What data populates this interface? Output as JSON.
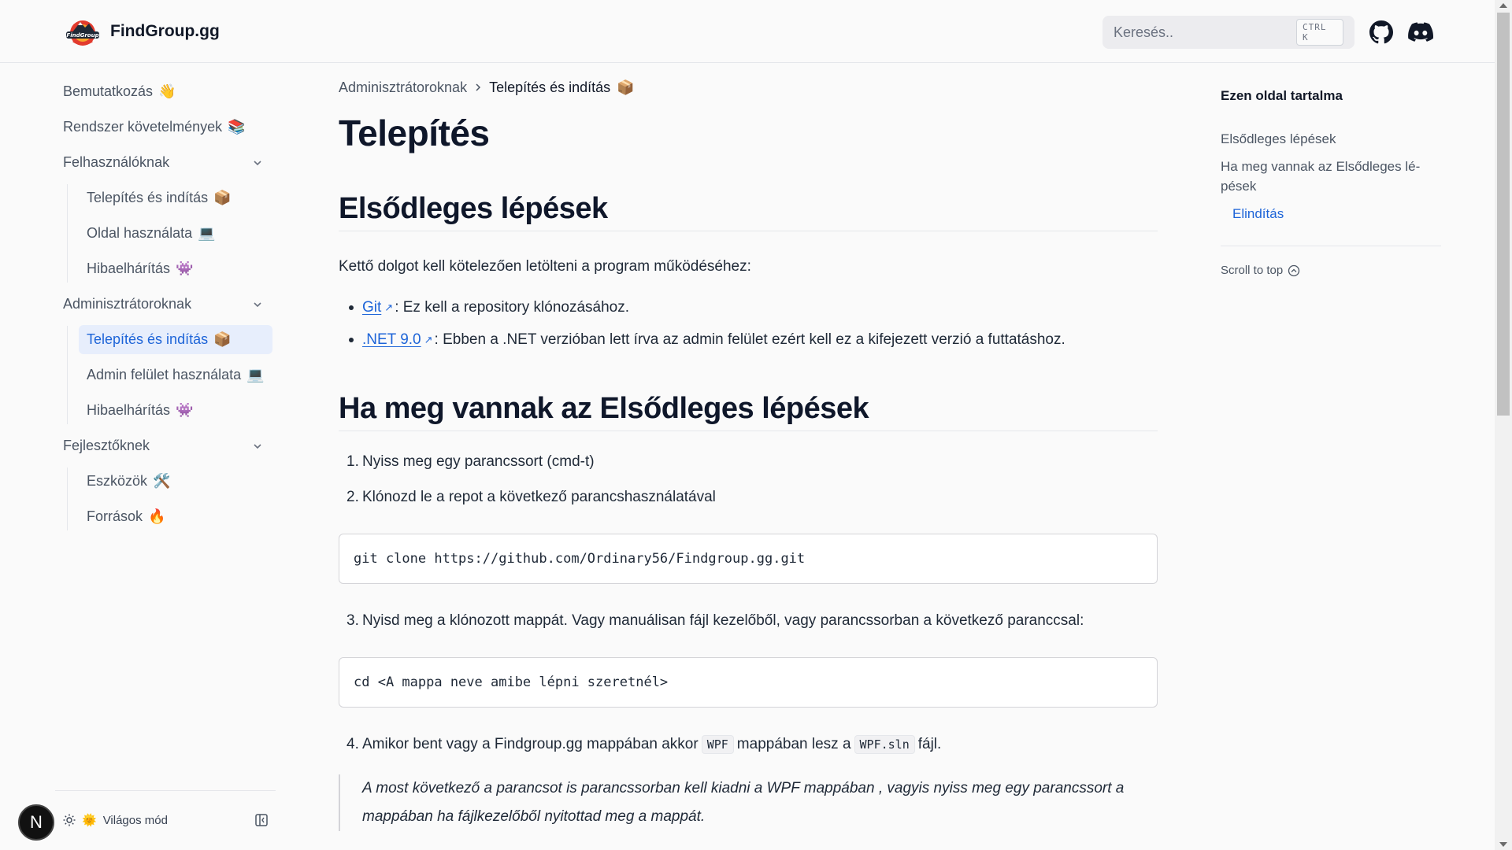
{
  "header": {
    "brand_name": "FindGroup.gg",
    "logo_text": "FindGroup",
    "search_placeholder": "Keresés..",
    "search_shortcut": "CTRL K"
  },
  "sidebar": {
    "items": [
      {
        "label": "Bemutatkozás",
        "emoji": "👋"
      },
      {
        "label": "Rendszer követelmények",
        "emoji": "📚"
      },
      {
        "label": "Felhasználóknak",
        "type": "group"
      },
      {
        "label": "Telepítés és indítás",
        "emoji": "📦"
      },
      {
        "label": "Oldal használata",
        "emoji": "💻"
      },
      {
        "label": "Hibaelhárítás",
        "emoji": "👾"
      },
      {
        "label": "Adminisztrátoroknak",
        "type": "group"
      },
      {
        "label": "Telepítés és indítás",
        "emoji": "📦",
        "active": true
      },
      {
        "label": "Admin felület használata",
        "emoji": "💻"
      },
      {
        "label": "Hibaelhárítás",
        "emoji": "👾"
      },
      {
        "label": "Fejlesztőknek",
        "type": "group"
      },
      {
        "label": "Eszközök",
        "emoji": "🛠️"
      },
      {
        "label": "Források",
        "emoji": "🔥"
      }
    ],
    "theme_label": "Világos mód",
    "badge_letter": "N"
  },
  "main": {
    "breadcrumb": [
      "Adminisztrátoroknak",
      "Telepítés és indítás"
    ],
    "breadcrumb_emoji": "📦",
    "title": "Telepítés",
    "section1": {
      "heading": "Elsődleges lépések",
      "intro": "Kettő dolgot kell kötelezően letölteni a program működéséhez:",
      "bullets": [
        {
          "link": "Git",
          "text": ": Ez kell a repository klónozásához."
        },
        {
          "link": ".NET 9.0",
          "text": ": Ebben a .NET verzióban lett írva az admin felület ezért kell ez a kifejezett verzió a futtatáshoz."
        }
      ]
    },
    "section2": {
      "heading": "Ha meg vannak az Elsődleges lépések",
      "step1": "Nyiss meg egy parancssort (cmd-t)",
      "step2": "Klónozd le a repot a következő parancshasználatával",
      "code1": "git clone https://github.com/Ordinary56/Findgroup.gg.git",
      "step3": "Nyisd meg a klónozott mappát. Vagy manuálisan fájl kezelőből, vagy parancssorban a következő paranccsal:",
      "code2": "cd <A mappa neve amibe lépni szeretnél>",
      "step4_a": "Amikor bent vagy a Findgroup.gg mappában akkor",
      "step4_code1": "WPF",
      "step4_b": "mappában lesz a",
      "step4_code2": "WPF.sln",
      "step4_c": "fájl.",
      "quote_line1": "A most következő a parancsot is parancssorban kell kiadni a WPF mappában , vagyis nyiss meg egy parancssort a",
      "quote_line2": "mappában ha fájlkezelőből nyitottad meg a mappát."
    }
  },
  "toc": {
    "title": "Ezen oldal tartalma",
    "items": [
      "Elsődleges lépések",
      "Ha meg vannak az Elsődleges lé-",
      "pések",
      "Elindítás"
    ],
    "scroll_top": "Scroll to top"
  },
  "colors": {
    "accent": "#1d64d8",
    "active_bg": "#e7eefc",
    "background": "#fafafa"
  }
}
